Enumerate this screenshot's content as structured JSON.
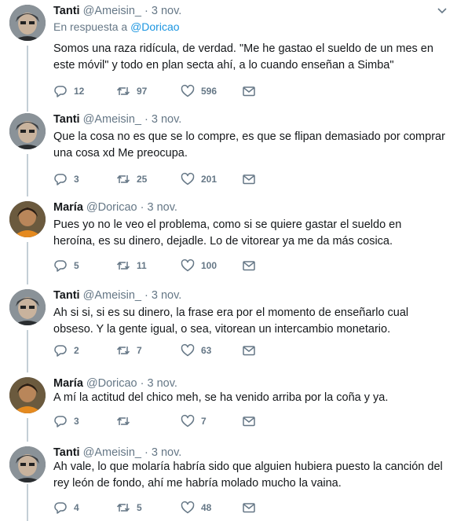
{
  "tweets": [
    {
      "avatar": "tanti",
      "name": "Tanti",
      "handle": "@Ameisin_",
      "date": "3 nov.",
      "reply_prefix": "En respuesta a",
      "reply_handle": "@Doricao",
      "text": "Somos una raza ridícula, de verdad. \"Me he gastao el sueldo de un mes en este móvil\" y todo en plan secta ahí, a lo cuando enseñan a Simba\"",
      "replies": "12",
      "retweets": "97",
      "likes": "596"
    },
    {
      "avatar": "tanti",
      "name": "Tanti",
      "handle": "@Ameisin_",
      "date": "3 nov.",
      "text": "Que la cosa no es que se lo compre, es que se flipan demasiado por comprar una cosa xd Me preocupa.",
      "replies": "3",
      "retweets": "25",
      "likes": "201"
    },
    {
      "avatar": "maria",
      "name": "María",
      "handle": "@Doricao",
      "date": "3 nov.",
      "text": "Pues yo no le veo el problema, como si se quiere gastar el sueldo en heroína, es su dinero, dejadle. Lo de vitorear ya me da más cosica.",
      "replies": "5",
      "retweets": "11",
      "likes": "100"
    },
    {
      "avatar": "tanti",
      "name": "Tanti",
      "handle": "@Ameisin_",
      "date": "3 nov.",
      "text": "Ah si si, si es su dinero, la frase era por el momento de enseñarlo cual obseso. Y la gente igual, o sea, vitorean un intercambio monetario.",
      "replies": "2",
      "retweets": "7",
      "likes": "63"
    },
    {
      "avatar": "maria",
      "name": "María",
      "handle": "@Doricao",
      "date": "3 nov.",
      "text": "A mí la actitud del chico meh, se ha venido arriba por la coña y ya.",
      "replies": "3",
      "retweets": "",
      "likes": "7"
    },
    {
      "avatar": "tanti",
      "name": "Tanti",
      "handle": "@Ameisin_",
      "date": "3 nov.",
      "text": "Ah vale, lo que molaría habría sido que alguien hubiera puesto la canción del rey león de fondo, ahí me habría molado mucho la vaina.",
      "replies": "4",
      "retweets": "5",
      "likes": "48"
    }
  ],
  "colors": {
    "text": "#14171a",
    "muted": "#657786",
    "link": "#1b95e0",
    "thread": "#c4cfd6"
  },
  "icons": [
    "reply-icon",
    "retweet-icon",
    "like-icon",
    "message-icon",
    "chevron-down-icon"
  ]
}
